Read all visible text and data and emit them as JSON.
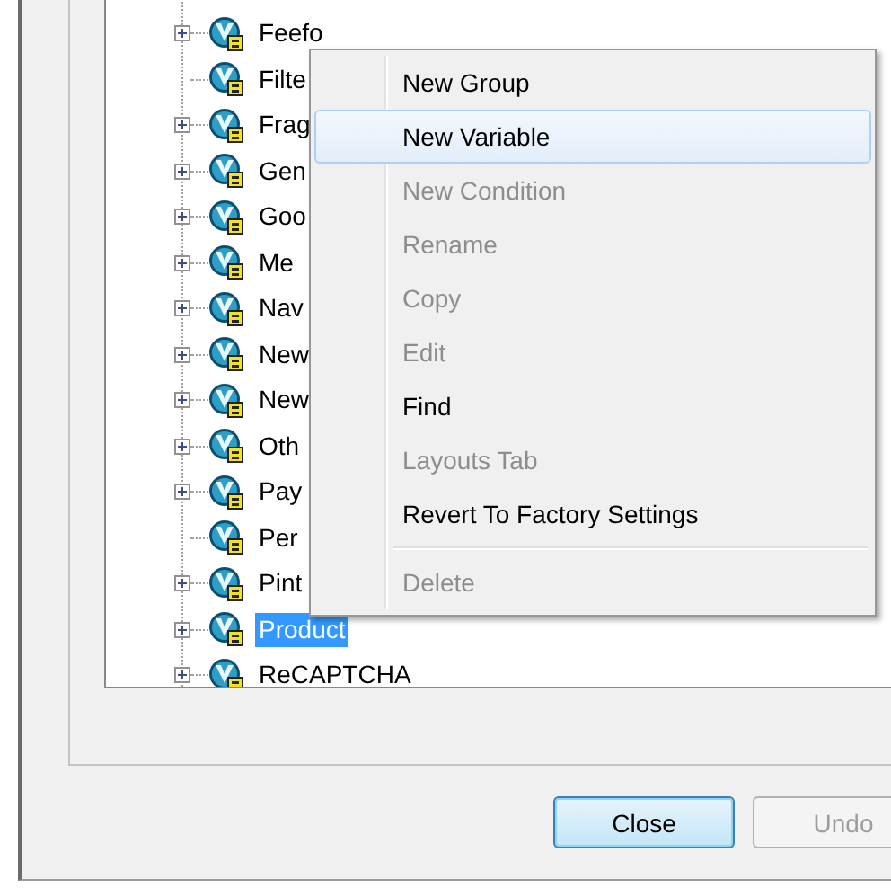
{
  "tree": {
    "items": [
      {
        "label": "Feefo",
        "expandable": true,
        "selected": false
      },
      {
        "label": "Filte",
        "expandable": false,
        "selected": false
      },
      {
        "label": "Frag",
        "expandable": true,
        "selected": false
      },
      {
        "label": "Gen",
        "expandable": true,
        "selected": false
      },
      {
        "label": "Goo",
        "expandable": true,
        "selected": false
      },
      {
        "label": "Me",
        "expandable": true,
        "selected": false
      },
      {
        "label": "Nav",
        "expandable": true,
        "selected": false
      },
      {
        "label": "New",
        "expandable": true,
        "selected": false
      },
      {
        "label": "New",
        "expandable": true,
        "selected": false
      },
      {
        "label": "Oth",
        "expandable": true,
        "selected": false
      },
      {
        "label": "Pay",
        "expandable": true,
        "selected": false
      },
      {
        "label": "Per",
        "expandable": false,
        "selected": false
      },
      {
        "label": "Pint",
        "expandable": true,
        "selected": false
      },
      {
        "label": "Product",
        "expandable": true,
        "selected": true
      },
      {
        "label": "ReCAPTCHA",
        "expandable": true,
        "selected": false
      }
    ]
  },
  "context_menu": {
    "items": [
      {
        "kind": "command",
        "label": "New Group",
        "disabled": false,
        "selected": false
      },
      {
        "kind": "command",
        "label": "New Variable",
        "disabled": false,
        "selected": true
      },
      {
        "kind": "command",
        "label": "New Condition",
        "disabled": true,
        "selected": false
      },
      {
        "kind": "command",
        "label": "Rename",
        "disabled": true,
        "selected": false
      },
      {
        "kind": "command",
        "label": "Copy",
        "disabled": true,
        "selected": false
      },
      {
        "kind": "command",
        "label": "Edit",
        "disabled": true,
        "selected": false
      },
      {
        "kind": "command",
        "label": "Find",
        "disabled": false,
        "selected": false
      },
      {
        "kind": "command",
        "label": "Layouts Tab",
        "disabled": true,
        "selected": false
      },
      {
        "kind": "command",
        "label": "Revert To Factory Settings",
        "disabled": false,
        "selected": false
      },
      {
        "kind": "separator"
      },
      {
        "kind": "command",
        "label": "Delete",
        "disabled": true,
        "selected": false
      }
    ]
  },
  "buttons": [
    {
      "label": "Close",
      "focused": true,
      "disabled": false
    },
    {
      "label": "Undo",
      "focused": false,
      "disabled": true
    }
  ]
}
